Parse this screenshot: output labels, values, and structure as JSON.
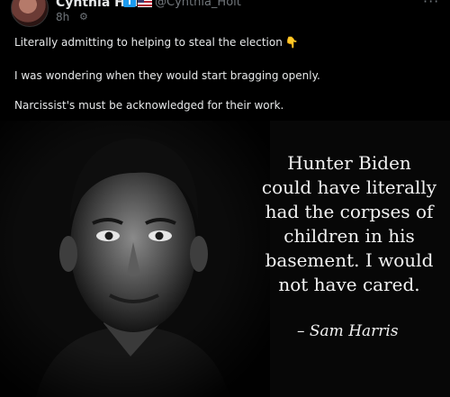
{
  "post": {
    "author_name": "Cynthia Holt",
    "badge_letter": "T",
    "handle": "@Cynthia_Holt",
    "time": "8h",
    "more_glyph": "···",
    "globe_glyph": "⚙",
    "lines": [
      "Literally admitting to helping to steal the election",
      "I was wondering when they would start bragging openly.",
      "Narcissist's must be acknowledged for their work."
    ],
    "emoji": "👇"
  },
  "image": {
    "quote_lines": [
      "Hunter Biden",
      "could have literally",
      "had the corpses of",
      "children in his",
      "basement. I would",
      "not have cared."
    ],
    "attribution": "– Sam Harris"
  },
  "colors": {
    "background": "#000000",
    "text": "#e7e9ea",
    "muted": "#71767b",
    "badge": "#1d9bf0"
  }
}
